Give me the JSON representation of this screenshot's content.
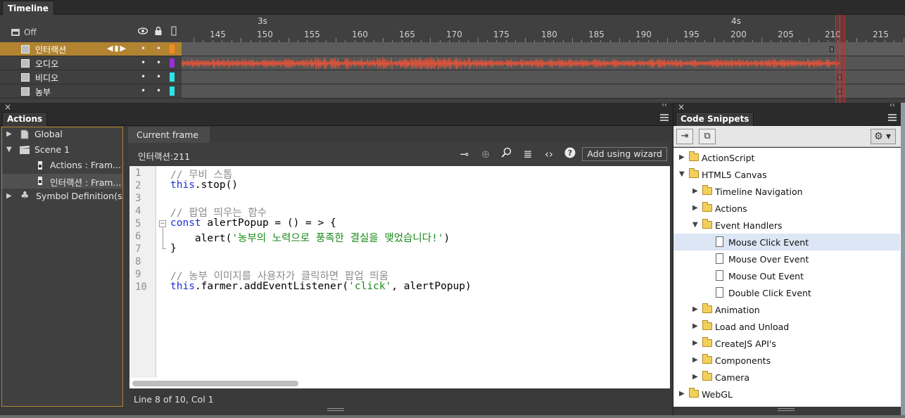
{
  "timeline": {
    "tab_label": "Timeline",
    "off_label": "Off",
    "seconds": [
      {
        "label": "3s"
      },
      {
        "label": "4s"
      }
    ],
    "frame_numbers": [
      "145",
      "150",
      "155",
      "160",
      "165",
      "170",
      "175",
      "180",
      "185",
      "190",
      "195",
      "200",
      "205",
      "210",
      "215"
    ],
    "current_frame": 211,
    "layers": [
      {
        "name": "인터랙션",
        "active": true,
        "color": "#f28c1e"
      },
      {
        "name": "오디오",
        "active": false,
        "color": "#9b2fd6"
      },
      {
        "name": "비디오",
        "active": false,
        "color": "#2fe3e3"
      },
      {
        "name": "농부",
        "active": false,
        "color": "#2fe3e3"
      }
    ]
  },
  "actions": {
    "tab_label": "Actions",
    "tree": [
      {
        "label": "Global"
      },
      {
        "label": "Scene 1"
      },
      {
        "label": "Actions : Fram..."
      },
      {
        "label": "인터랙션 : Fram..."
      },
      {
        "label": "Symbol Definition(s)"
      }
    ],
    "frame_tab": "Current frame",
    "frame_name": "인터랙션:211",
    "wizard_label": "Add using wizard",
    "line_numbers": [
      "1",
      "2",
      "3",
      "4",
      "5",
      "6",
      "7",
      "8",
      "9",
      "10"
    ],
    "code": {
      "l1": "// 무비 스톱",
      "l2_kw": "this",
      "l2_rest": ".stop()",
      "l4": "// 팝업 띄우는 함수",
      "l5_kw": "const",
      "l5_rest": " alertPopup = () = > {",
      "l6_pre": "    alert(",
      "l6_str": "'농부의 노력으로 풍족한 결실을 맺었습니다!'",
      "l6_post": ")",
      "l7": "}",
      "l9": "// 농부 이미지를 사용자가 클릭하면 팝업 띄움",
      "l10_kw": "this",
      "l10_mid": ".farmer.addEventListener(",
      "l10_str": "'click'",
      "l10_post": ", alertPopup)"
    },
    "status": "Line 8 of 10, Col 1"
  },
  "snippets": {
    "tab_label": "Code Snippets",
    "items": [
      {
        "label": "ActionScript"
      },
      {
        "label": "HTML5 Canvas"
      },
      {
        "label": "Timeline Navigation"
      },
      {
        "label": "Actions"
      },
      {
        "label": "Event Handlers"
      },
      {
        "label": "Mouse Click Event"
      },
      {
        "label": "Mouse Over Event"
      },
      {
        "label": "Mouse Out Event"
      },
      {
        "label": "Double Click Event"
      },
      {
        "label": "Animation"
      },
      {
        "label": "Load and Unload"
      },
      {
        "label": "CreateJS API's"
      },
      {
        "label": "Components"
      },
      {
        "label": "Camera"
      },
      {
        "label": "WebGL"
      }
    ]
  },
  "icons": {
    "eye": "eye-icon",
    "lock": "lock-icon",
    "outline": "outline-icon",
    "gear": "gear-icon"
  },
  "colors": {
    "active_layer": "#b28431",
    "playhead": "#c8302c",
    "waveform": "#e0533a",
    "selection": "#dce6f4"
  }
}
